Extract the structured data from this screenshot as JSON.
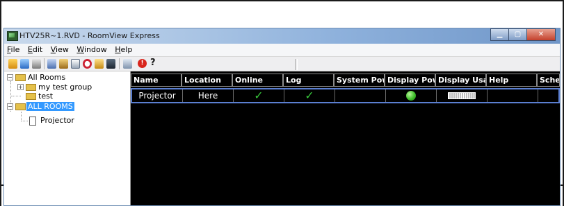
{
  "window": {
    "title": "HTV25R~1.RVD - RoomView Express"
  },
  "menu": [
    {
      "label": "File",
      "key": "F",
      "rest": "ile"
    },
    {
      "label": "Edit",
      "key": "E",
      "rest": "dit"
    },
    {
      "label": "View",
      "key": "V",
      "rest": "iew"
    },
    {
      "label": "Window",
      "key": "W",
      "rest": "indow"
    },
    {
      "label": "Help",
      "key": "H",
      "rest": "elp"
    }
  ],
  "toolbar": {
    "help_glyph": "?",
    "stop_glyph": "!"
  },
  "tree": {
    "root": "All Rooms",
    "children": [
      {
        "label": "my test group",
        "expander": "+"
      },
      {
        "label": "test"
      },
      {
        "label": "ALL ROOMS",
        "expander": "−",
        "selected": true
      }
    ],
    "device": "Projector",
    "root_expander": "−"
  },
  "grid": {
    "columns": [
      "Name",
      "Location",
      "Online",
      "Log",
      "System Power",
      "Display Power",
      "Display Usage",
      "Help",
      "Sched"
    ],
    "rows": [
      {
        "name": "Projector",
        "location": "Here",
        "online": "✓",
        "log": "✓",
        "system_power": "",
        "display_power": "on",
        "display_usage": "lamp-meter",
        "help": "",
        "sched": ""
      }
    ]
  },
  "colors": {
    "grid_bg": "#000000",
    "selected_row_border": "#5b7fd1",
    "check": "#37c43a",
    "tree_selection": "#3399ff"
  }
}
